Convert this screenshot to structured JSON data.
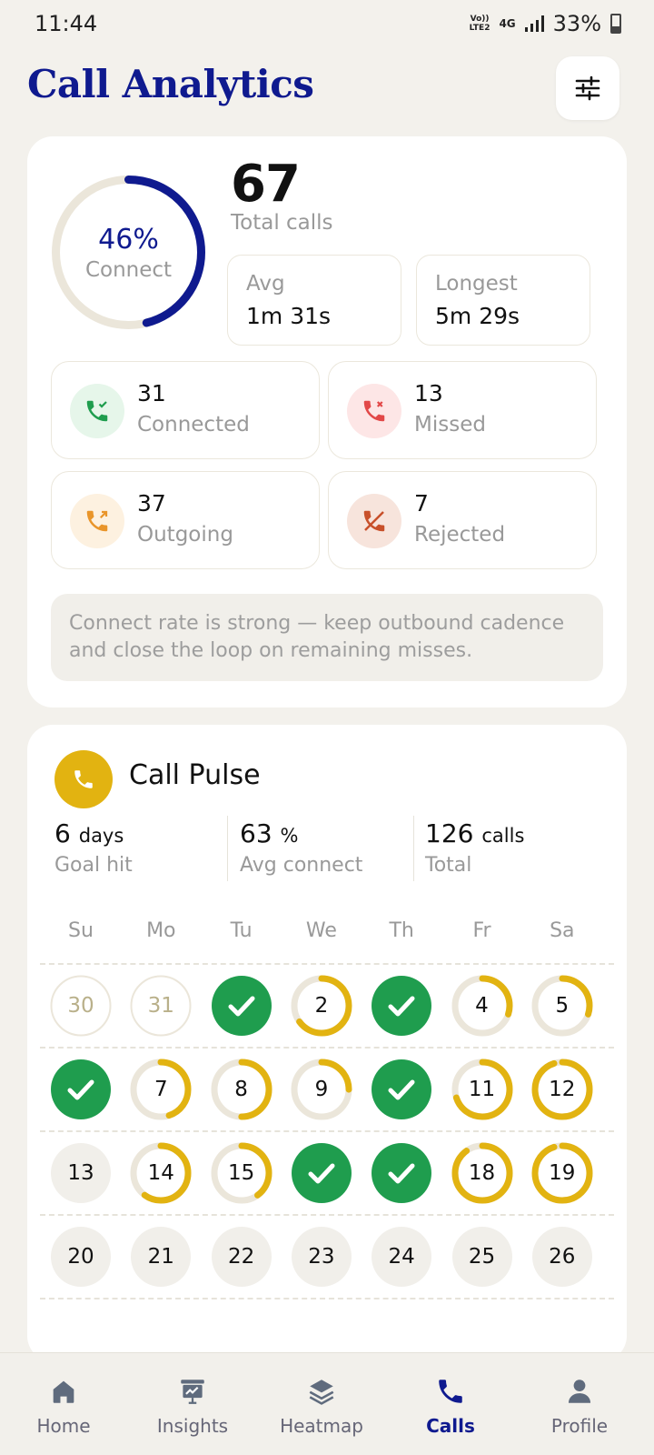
{
  "status_bar": {
    "time": "11:44",
    "network_top": "Vo))",
    "network_bottom": "LTE2",
    "network_type": "4G",
    "battery": "33%"
  },
  "header": {
    "title": "Call Analytics",
    "filter_icon": "sliders-icon"
  },
  "summary": {
    "connect_pct_label": "46%",
    "connect_fraction": 0.46,
    "connect_label": "Connect",
    "total_calls": "67",
    "total_label": "Total calls",
    "avg_label": "Avg",
    "avg_value": "1m 31s",
    "longest_label": "Longest",
    "longest_value": "5m 29s",
    "stats": [
      {
        "value": "31",
        "label": "Connected",
        "icon": "phone-check-icon",
        "color": "#1f9d4e",
        "bg": "#e6f6ea"
      },
      {
        "value": "13",
        "label": "Missed",
        "icon": "phone-missed-icon",
        "color": "#e24848",
        "bg": "#fde6e6"
      },
      {
        "value": "37",
        "label": "Outgoing",
        "icon": "phone-outgoing-icon",
        "color": "#e9952a",
        "bg": "#fdf1e0"
      },
      {
        "value": "7",
        "label": "Rejected",
        "icon": "phone-rejected-icon",
        "color": "#c8502a",
        "bg": "#f7e4dc"
      }
    ],
    "insight": "Connect rate is strong — keep outbound cadence and close the loop on remaining misses."
  },
  "pulse": {
    "title": "Call Pulse",
    "goal_value": "6",
    "goal_unit": "days",
    "goal_label": "Goal hit",
    "avg_value": "63",
    "avg_unit": "%",
    "avg_label": "Avg connect",
    "total_value": "126",
    "total_unit": "calls",
    "total_label": "Total",
    "weekdays": [
      "Su",
      "Mo",
      "Tu",
      "We",
      "Th",
      "Fr",
      "Sa"
    ],
    "weeks": [
      [
        {
          "d": "30",
          "s": "muted"
        },
        {
          "d": "31",
          "s": "muted"
        },
        {
          "d": "",
          "s": "done"
        },
        {
          "d": "2",
          "s": "ring",
          "p": 0.65
        },
        {
          "d": "",
          "s": "done"
        },
        {
          "d": "4",
          "s": "ring",
          "p": 0.3
        },
        {
          "d": "5",
          "s": "ring",
          "p": 0.3
        }
      ],
      [
        {
          "d": "",
          "s": "done"
        },
        {
          "d": "7",
          "s": "ring",
          "p": 0.45
        },
        {
          "d": "8",
          "s": "ring",
          "p": 0.5
        },
        {
          "d": "9",
          "s": "ring",
          "p": 0.25
        },
        {
          "d": "",
          "s": "done"
        },
        {
          "d": "11",
          "s": "ring",
          "p": 0.7
        },
        {
          "d": "12",
          "s": "ring",
          "p": 0.95
        }
      ],
      [
        {
          "d": "13",
          "s": "plain"
        },
        {
          "d": "14",
          "s": "ring",
          "p": 0.6
        },
        {
          "d": "15",
          "s": "ring",
          "p": 0.4
        },
        {
          "d": "",
          "s": "done"
        },
        {
          "d": "",
          "s": "done"
        },
        {
          "d": "18",
          "s": "ring",
          "p": 0.9
        },
        {
          "d": "19",
          "s": "ring",
          "p": 0.95
        }
      ],
      [
        {
          "d": "20",
          "s": "plain"
        },
        {
          "d": "21",
          "s": "plain"
        },
        {
          "d": "22",
          "s": "plain"
        },
        {
          "d": "23",
          "s": "plain"
        },
        {
          "d": "24",
          "s": "plain"
        },
        {
          "d": "25",
          "s": "plain"
        },
        {
          "d": "26",
          "s": "plain"
        }
      ]
    ]
  },
  "tabs": [
    {
      "label": "Home",
      "icon": "home-icon",
      "active": false
    },
    {
      "label": "Insights",
      "icon": "insights-icon",
      "active": false
    },
    {
      "label": "Heatmap",
      "icon": "layers-icon",
      "active": false
    },
    {
      "label": "Calls",
      "icon": "phone-icon",
      "active": true
    },
    {
      "label": "Profile",
      "icon": "profile-icon",
      "active": false
    }
  ],
  "colors": {
    "accent": "#0f1a8f",
    "gold": "#e2b311",
    "green": "#1f9d4e",
    "track": "#ebe6da"
  }
}
